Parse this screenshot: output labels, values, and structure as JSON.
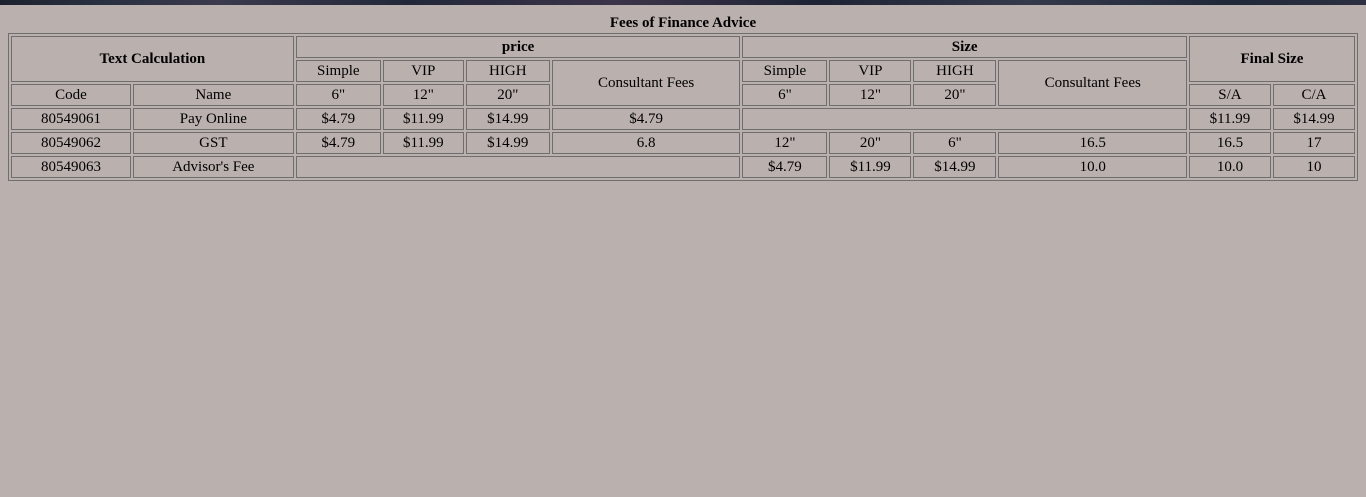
{
  "caption": "Fees of Finance Advice",
  "groups": {
    "text_calc": "Text Calculation",
    "price": "price",
    "size": "Size",
    "final_size": "Final Size"
  },
  "sub": {
    "simple": "Simple",
    "vip": "VIP",
    "high": "HIGH",
    "consultant": "Consultant Fees",
    "code": "Code",
    "name": "Name",
    "sa": "S/A",
    "ca": "C/A",
    "six": "6\"",
    "twelve": "12\"",
    "twenty": "20\""
  },
  "rows": [
    {
      "code": "80549061",
      "name": "Pay Online",
      "price": [
        "$4.79",
        "$11.99",
        "$14.99",
        "$4.79"
      ],
      "final": [
        "$11.99",
        "$14.99"
      ]
    },
    {
      "code": "80549062",
      "name": "GST",
      "price": [
        "$4.79",
        "$11.99",
        "$14.99",
        "6.8"
      ],
      "size": [
        "12\"",
        "20\"",
        "6\"",
        "16.5"
      ],
      "final": [
        "16.5",
        "17"
      ]
    },
    {
      "code": "80549063",
      "name": "Advisor's Fee",
      "size": [
        "$4.79",
        "$11.99",
        "$14.99",
        "10.0"
      ],
      "final": [
        "10.0",
        "10"
      ]
    }
  ]
}
